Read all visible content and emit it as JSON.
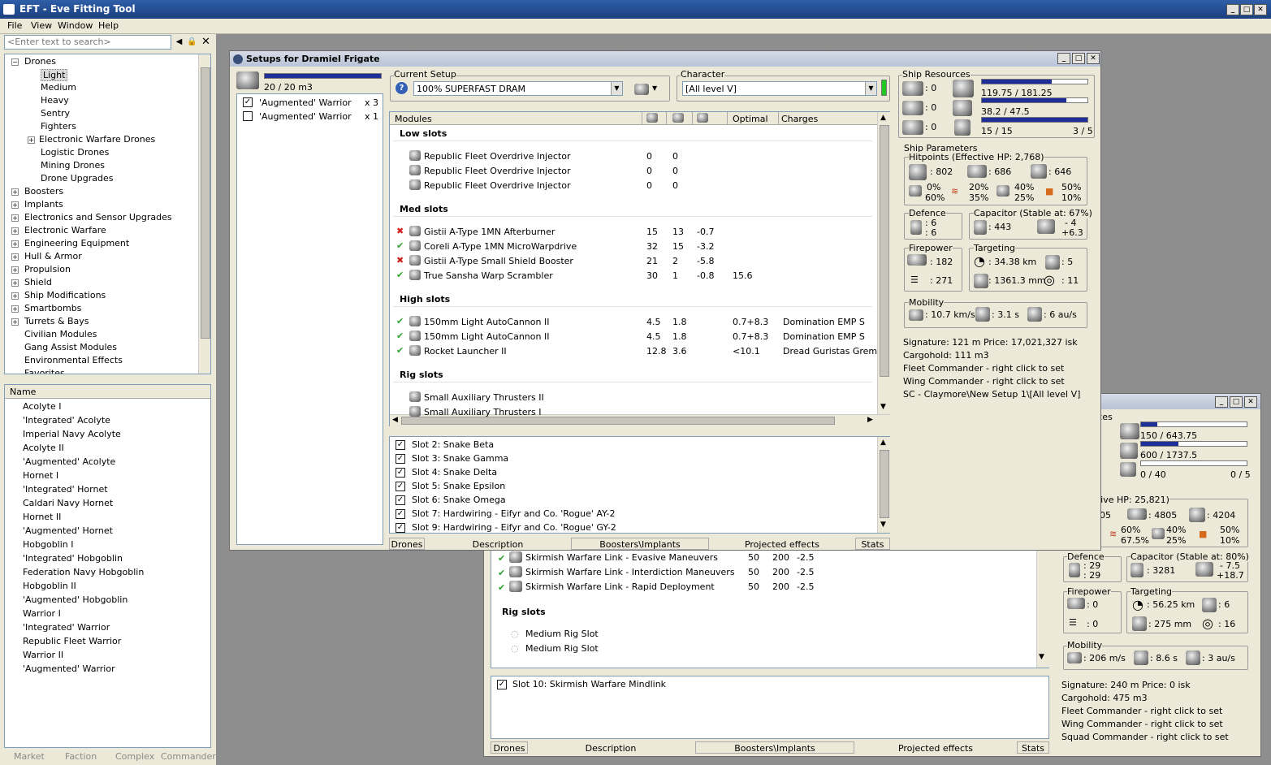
{
  "app": {
    "title": "EFT - Eve Fitting Tool"
  },
  "menu": [
    "File",
    "View",
    "Window",
    "Help"
  ],
  "search": {
    "placeholder": "<Enter text to search>"
  },
  "tree": [
    {
      "label": "Drones",
      "expanded": true,
      "indent": 0
    },
    {
      "label": "Light",
      "indent": 2,
      "selected": true
    },
    {
      "label": "Medium",
      "indent": 2
    },
    {
      "label": "Heavy",
      "indent": 2
    },
    {
      "label": "Sentry",
      "indent": 2
    },
    {
      "label": "Fighters",
      "indent": 2
    },
    {
      "label": "Electronic Warfare Drones",
      "indent": 1
    },
    {
      "label": "Logistic Drones",
      "indent": 2
    },
    {
      "label": "Mining Drones",
      "indent": 2
    },
    {
      "label": "Drone Upgrades",
      "indent": 2
    },
    {
      "label": "Boosters",
      "indent": 0
    },
    {
      "label": "Implants",
      "indent": 0
    },
    {
      "label": "Electronics and Sensor Upgrades",
      "indent": 0
    },
    {
      "label": "Electronic Warfare",
      "indent": 0
    },
    {
      "label": "Engineering Equipment",
      "indent": 0
    },
    {
      "label": "Hull & Armor",
      "indent": 0
    },
    {
      "label": "Propulsion",
      "indent": 0
    },
    {
      "label": "Shield",
      "indent": 0
    },
    {
      "label": "Ship Modifications",
      "indent": 0
    },
    {
      "label": "Smartbombs",
      "indent": 0
    },
    {
      "label": "Turrets & Bays",
      "indent": 0
    },
    {
      "label": "Civilian Modules",
      "indent": 0,
      "leaf": true
    },
    {
      "label": "Gang Assist Modules",
      "indent": 0,
      "leaf": true
    },
    {
      "label": "Environmental Effects",
      "indent": 0,
      "leaf": true
    },
    {
      "label": "Favorites",
      "indent": 0,
      "leaf": true
    }
  ],
  "namelist": {
    "header": "Name",
    "items": [
      "Acolyte I",
      "'Integrated' Acolyte",
      "Imperial Navy Acolyte",
      "Acolyte II",
      "'Augmented' Acolyte",
      "Hornet I",
      "'Integrated' Hornet",
      "Caldari Navy Hornet",
      "Hornet II",
      "'Augmented' Hornet",
      "Hobgoblin I",
      "'Integrated' Hobgoblin",
      "Federation Navy Hobgoblin",
      "Hobgoblin II",
      "'Augmented' Hobgoblin",
      "Warrior I",
      "'Integrated' Warrior",
      "Republic Fleet Warrior",
      "Warrior II",
      "'Augmented' Warrior"
    ]
  },
  "bottomtabs": [
    "Market",
    "Faction",
    "Complex",
    "Commander"
  ],
  "front": {
    "title": "Setups for Dramiel Frigate",
    "drone_bay": "20 / 20 m3",
    "drones": [
      {
        "name": "'Augmented' Warrior",
        "qty": "x 3",
        "checked": true
      },
      {
        "name": "'Augmented' Warrior",
        "qty": "x 1",
        "checked": false
      }
    ],
    "current_setup_label": "Current Setup",
    "current_setup": "100% SUPERFAST DRAM",
    "character_label": "Character",
    "character": "[All level V]",
    "columns": {
      "modules": "Modules",
      "optimal": "Optimal",
      "charges": "Charges"
    },
    "sections": [
      {
        "title": "Low slots",
        "rows": [
          {
            "status": "",
            "name": "Republic Fleet Overdrive Injector",
            "c1": "0",
            "c2": "0",
            "c3": "",
            "optimal": "",
            "charge": ""
          },
          {
            "status": "",
            "name": "Republic Fleet Overdrive Injector",
            "c1": "0",
            "c2": "0",
            "c3": "",
            "optimal": "",
            "charge": ""
          },
          {
            "status": "",
            "name": "Republic Fleet Overdrive Injector",
            "c1": "0",
            "c2": "0",
            "c3": "",
            "optimal": "",
            "charge": ""
          }
        ]
      },
      {
        "title": "Med slots",
        "rows": [
          {
            "status": "x",
            "name": "Gistii A-Type 1MN Afterburner",
            "c1": "15",
            "c2": "13",
            "c3": "-0.7",
            "optimal": "",
            "charge": ""
          },
          {
            "status": "ok",
            "name": "Coreli A-Type 1MN MicroWarpdrive",
            "c1": "32",
            "c2": "15",
            "c3": "-3.2",
            "optimal": "",
            "charge": ""
          },
          {
            "status": "x",
            "name": "Gistii A-Type Small Shield Booster",
            "c1": "21",
            "c2": "2",
            "c3": "-5.8",
            "optimal": "",
            "charge": ""
          },
          {
            "status": "ok",
            "name": "True Sansha Warp Scrambler",
            "c1": "30",
            "c2": "1",
            "c3": "-0.8",
            "optimal": "15.6",
            "charge": ""
          }
        ]
      },
      {
        "title": "High slots",
        "rows": [
          {
            "status": "ok",
            "name": "150mm Light AutoCannon II",
            "c1": "4.5",
            "c2": "1.8",
            "c3": "",
            "optimal": "0.7+8.3",
            "charge": "Domination EMP S"
          },
          {
            "status": "ok",
            "name": "150mm Light AutoCannon II",
            "c1": "4.5",
            "c2": "1.8",
            "c3": "",
            "optimal": "0.7+8.3",
            "charge": "Domination EMP S"
          },
          {
            "status": "ok",
            "name": "Rocket Launcher II",
            "c1": "12.8",
            "c2": "3.6",
            "c3": "",
            "optimal": "<10.1",
            "charge": "Dread Guristas Gremlir"
          }
        ]
      },
      {
        "title": "Rig slots",
        "rows": [
          {
            "status": "",
            "name": "Small Auxiliary Thrusters II",
            "c1": "",
            "c2": "",
            "c3": "",
            "optimal": "",
            "charge": ""
          },
          {
            "status": "",
            "name": "Small Auxiliary Thrusters I",
            "c1": "",
            "c2": "",
            "c3": "",
            "optimal": "",
            "charge": ""
          }
        ]
      }
    ],
    "implants": [
      "Slot 2: Snake Beta",
      "Slot 3: Snake Gamma",
      "Slot 4: Snake Delta",
      "Slot 5: Snake Epsilon",
      "Slot 6: Snake Omega",
      "Slot 7: Hardwiring - Eifyr and Co. 'Rogue' AY-2",
      "Slot 9: Hardwiring - Eifyr and Co. 'Rogue' GY-2"
    ],
    "tabs": [
      "Drones",
      "Description",
      "Boosters\\Implants",
      "Projected effects",
      "Stats"
    ],
    "resources": {
      "label": "Ship Resources",
      "hi": "0",
      "turret": "0",
      "launcher": "0",
      "cpu": "119.75 / 181.25",
      "cpu_fill": 0.66,
      "pg": "38.2 / 47.5",
      "pg_fill": 0.8,
      "calib": "15 / 15",
      "calib_fill": 1.0,
      "drones": "3 / 5"
    },
    "params_label": "Ship Parameters",
    "hp": {
      "label": "Hitpoints (Effective HP: 2,768)",
      "shield": ": 802",
      "armor": ": 686",
      "hull": ": 646",
      "em1": "0%",
      "em2": "60%",
      "th1": "20%",
      "th2": "35%",
      "ki1": "40%",
      "ki2": "25%",
      "ex1": "50%",
      "ex2": "10%"
    },
    "defence": {
      "label": "Defence",
      "v1": ": 6",
      "v2": ": 6"
    },
    "capacitor": {
      "label": "Capacitor (Stable at: 67%)",
      "cap": ": 443",
      "d1": "- 4",
      "d2": "+6.3"
    },
    "firepower": {
      "label": "Firepower",
      "v1": ": 182",
      "v2": ": 271"
    },
    "targeting": {
      "label": "Targeting",
      "range": ": 34.38 km",
      "targets": ": 5",
      "res": ": 1361.3 mm",
      "scan": ": 11"
    },
    "mobility": {
      "label": "Mobility",
      "speed": ": 10.7 km/s",
      "align": ": 3.1 s",
      "warp": ": 6 au/s"
    },
    "info": [
      "Signature: 121 m    Price: 17,021,327 isk",
      "Cargohold: 111 m3",
      "Fleet Commander - right click to set",
      "Wing Commander - right click to set",
      "SC - Claymore\\New Setup 1\\[All level V]"
    ]
  },
  "back": {
    "res_label": "urces",
    "cpu": "150 / 643.75",
    "cpu_fill": 0.15,
    "pg": "600 / 1737.5",
    "pg_fill": 0.35,
    "calib": "0 / 40",
    "drones": "0 / 5",
    "params_label": "meters",
    "hp_label": "s (Effective HP: 25,821)",
    "shield": "05",
    "armor": ": 4805",
    "hull": ": 4204",
    "th1": "60%",
    "th2": "67.5%",
    "ki1": "40%",
    "ki2": "25%",
    "ex1": "50%",
    "ex2": "10%",
    "defence": {
      "label": "Defence",
      "v1": ": 29",
      "v2": ": 29"
    },
    "capacitor": {
      "label": "Capacitor (Stable at: 80%)",
      "cap": ": 3281",
      "d1": "- 7.5",
      "d2": "+18.7"
    },
    "firepower": {
      "label": "Firepower",
      "v1": ": 0",
      "v2": ": 0"
    },
    "targeting": {
      "label": "Targeting",
      "range": ": 56.25 km",
      "targets": ": 6",
      "res": ": 275 mm",
      "scan": ": 16"
    },
    "mobility": {
      "label": "Mobility",
      "speed": ": 206 m/s",
      "align": ": 8.6 s",
      "warp": ": 3 au/s"
    },
    "info": [
      "Signature: 240 m     Price: 0 isk",
      "Cargohold: 475 m3",
      "Fleet Commander - right click to set",
      "Wing Commander - right click to set",
      "Squad Commander - right click to set"
    ],
    "links": [
      {
        "name": "Skirmish Warfare Link - Evasive Maneuvers",
        "c1": "50",
        "c2": "200",
        "c3": "-2.5"
      },
      {
        "name": "Skirmish Warfare Link - Interdiction Maneuvers",
        "c1": "50",
        "c2": "200",
        "c3": "-2.5"
      },
      {
        "name": "Skirmish Warfare Link - Rapid Deployment",
        "c1": "50",
        "c2": "200",
        "c3": "-2.5"
      }
    ],
    "rig_title": "Rig slots",
    "rigs": [
      "Medium Rig Slot",
      "Medium Rig Slot"
    ],
    "implant": "Slot 10: Skirmish Warfare Mindlink",
    "tabs": [
      "Drones",
      "Description",
      "Boosters\\Implants",
      "Projected effects",
      "Stats"
    ]
  },
  "colors": {
    "bar": "#1f2f9a",
    "title_bg": "#2f5fa8",
    "window_bg": "#ece9d8",
    "ok": "#2fa12f",
    "error": "#d02020"
  }
}
